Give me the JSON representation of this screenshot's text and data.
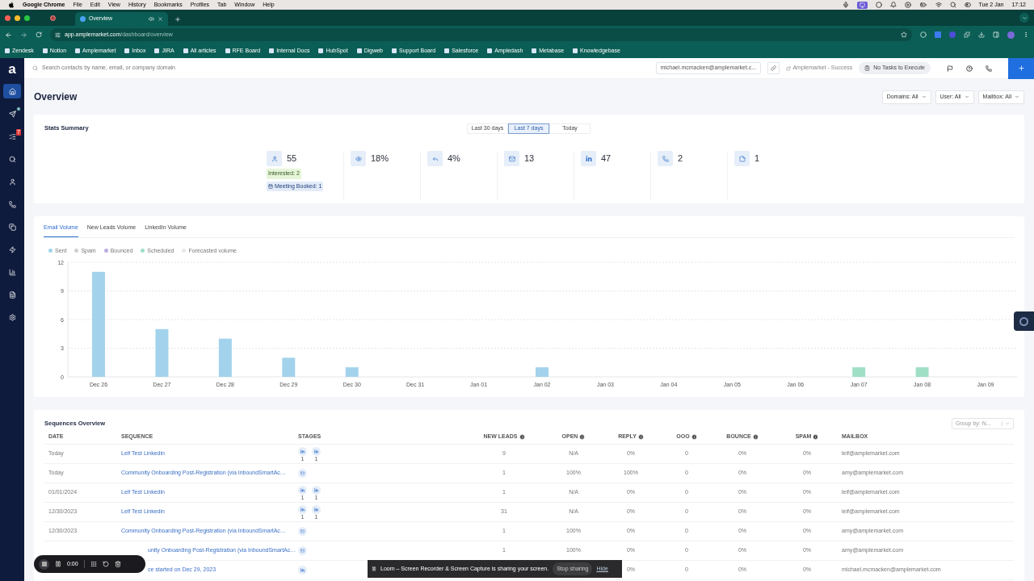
{
  "menubar": {
    "app": "Google Chrome",
    "menus": [
      "File",
      "Edit",
      "View",
      "History",
      "Bookmarks",
      "Profiles",
      "Tab",
      "Window",
      "Help"
    ],
    "date": "Tue 2 Jan",
    "time": "17:12"
  },
  "browser": {
    "tab_title": "Overview",
    "url_host": "app.amplemarket.com",
    "url_path": "/dashboard/overview",
    "bookmarks": [
      "Zendesk",
      "Notion",
      "Amplemarket",
      "Inbox",
      "JIRA",
      "All articles",
      "RFE Board",
      "Internal Docs",
      "HubSpot",
      "Digweb",
      "Support Board",
      "Salesforce",
      "Ampledash",
      "Metabase",
      "Knowledgebase"
    ]
  },
  "sidebar": {
    "logo": "a",
    "items": [
      {
        "selected": true,
        "indicator": false
      },
      {
        "selected": false,
        "indicator": true
      },
      {
        "selected": false,
        "indicator": false,
        "badge": "7"
      },
      {
        "selected": false,
        "indicator": false
      },
      {
        "selected": false,
        "indicator": false
      },
      {
        "selected": false,
        "indicator": false
      },
      {
        "selected": false,
        "indicator": false
      },
      {
        "selected": false,
        "indicator": false
      },
      {
        "selected": false,
        "indicator": false
      },
      {
        "selected": false,
        "indicator": false
      },
      {
        "selected": false,
        "indicator": false
      }
    ]
  },
  "topbar": {
    "search_placeholder": "Search contacts by name, email, or company domain",
    "account": "michael.mcmacken@amplemarket.c...",
    "link": "Amplemarket - Success",
    "tasks": "No Tasks to Execute"
  },
  "page": {
    "title": "Overview",
    "filters": [
      "Domains: All",
      "User: All",
      "Mailbox: All"
    ]
  },
  "stats": {
    "title": "Stats Summary",
    "ranges": [
      {
        "label": "Last 30 days",
        "selected": false
      },
      {
        "label": "Last 7 days",
        "selected": true
      },
      {
        "label": "Today",
        "selected": false
      }
    ],
    "items": [
      {
        "value": "55",
        "badges": [
          {
            "kind": "interest",
            "text": "Interested: 2"
          },
          {
            "kind": "meeting",
            "text": "Meeting Booked: 1"
          }
        ]
      },
      {
        "value": "18%"
      },
      {
        "value": "4%"
      },
      {
        "value": "13"
      },
      {
        "value": "47"
      },
      {
        "value": "2"
      },
      {
        "value": "1"
      }
    ]
  },
  "volume": {
    "tabs": [
      {
        "label": "Email Volume",
        "selected": true
      },
      {
        "label": "New Leads Volume",
        "selected": false
      },
      {
        "label": "LinkedIn Volume",
        "selected": false
      }
    ],
    "chart_data": {
      "type": "bar",
      "stacked": true,
      "grid": true,
      "categories": [
        "Dec 26",
        "Dec 27",
        "Dec 28",
        "Dec 29",
        "Dec 30",
        "Dec 31",
        "Jan 01",
        "Jan 02",
        "Jan 03",
        "Jan 04",
        "Jan 05",
        "Jan 06",
        "Jan 07",
        "Jan 08",
        "Jan 09"
      ],
      "ylim": [
        0,
        12
      ],
      "yticks": [
        0,
        3,
        6,
        9,
        12
      ],
      "series": [
        {
          "name": "Sent",
          "color": "#a3d3ec",
          "values": [
            11,
            5,
            4,
            2,
            1,
            0,
            0,
            1,
            0,
            0,
            0,
            0,
            0,
            0,
            0
          ]
        },
        {
          "name": "Spam",
          "color": "#cfcfcf",
          "values": [
            0,
            0,
            0,
            0,
            0,
            0,
            0,
            0,
            0,
            0,
            0,
            0,
            0,
            0,
            0
          ]
        },
        {
          "name": "Bounced",
          "color": "#bcaee0",
          "values": [
            0,
            0,
            0,
            0,
            0,
            0,
            0,
            0,
            0,
            0,
            0,
            0,
            0,
            0,
            0
          ]
        },
        {
          "name": "Scheduled",
          "color": "#9fdfc6",
          "values": [
            0,
            0,
            0,
            0,
            0,
            0,
            0,
            0,
            0,
            0,
            0,
            0,
            1,
            1,
            0
          ]
        },
        {
          "name": "Forecasted volume",
          "color": "#e8e8e8",
          "values": [
            0,
            0,
            0,
            0,
            0,
            0,
            0,
            0,
            0,
            0,
            0,
            0,
            0,
            0,
            0
          ]
        }
      ]
    }
  },
  "sequences": {
    "title": "Sequences Overview",
    "group_by": "Group by: N...",
    "columns": [
      {
        "label": "DATE",
        "info": false
      },
      {
        "label": "SEQUENCE",
        "info": false
      },
      {
        "label": "STAGES",
        "info": false
      },
      {
        "label": "NEW LEADS",
        "info": true
      },
      {
        "label": "OPEN",
        "info": true
      },
      {
        "label": "REPLY",
        "info": true
      },
      {
        "label": "OOO",
        "info": true
      },
      {
        "label": "BOUNCE",
        "info": true
      },
      {
        "label": "SPAM",
        "info": true
      },
      {
        "label": "MAILBOX",
        "info": false
      }
    ],
    "rows": [
      {
        "date": "Today",
        "sequence": "Leif Test Linkedin",
        "stages": [
          {
            "kind": "linkedin",
            "count": "1"
          },
          {
            "kind": "linkedin",
            "count": "1"
          }
        ],
        "new_leads": "9",
        "open": "N/A",
        "reply": "0%",
        "ooo": "0",
        "bounce": "0%",
        "spam": "0%",
        "mailbox": "leif@amplemarket.com"
      },
      {
        "date": "Today",
        "sequence": "Community Onboarding Post-Registration (via InboundSmartAc…",
        "stages": [
          {
            "kind": "email"
          }
        ],
        "new_leads": "1",
        "open": "100%",
        "reply": "100%",
        "ooo": "0",
        "bounce": "0%",
        "spam": "0%",
        "mailbox": "amy@amplemarket.com"
      },
      {
        "date": "01/01/2024",
        "sequence": "Leif Test Linkedin",
        "stages": [
          {
            "kind": "linkedin",
            "count": "1"
          },
          {
            "kind": "linkedin",
            "count": "1"
          }
        ],
        "new_leads": "1",
        "open": "N/A",
        "reply": "0%",
        "ooo": "0",
        "bounce": "0%",
        "spam": "0%",
        "mailbox": "leif@amplemarket.com"
      },
      {
        "date": "12/30/2023",
        "sequence": "Leif Test Linkedin",
        "stages": [
          {
            "kind": "linkedin",
            "count": "1"
          },
          {
            "kind": "linkedin",
            "count": "1"
          }
        ],
        "new_leads": "31",
        "open": "N/A",
        "reply": "0%",
        "ooo": "0",
        "bounce": "0%",
        "spam": "0%",
        "mailbox": "leif@amplemarket.com"
      },
      {
        "date": "12/30/2023",
        "sequence": "Community Onboarding Post-Registration (via InboundSmartAc…",
        "stages": [
          {
            "kind": "email"
          }
        ],
        "new_leads": "1",
        "open": "100%",
        "reply": "0%",
        "ooo": "0",
        "bounce": "0%",
        "spam": "0%",
        "mailbox": "amy@amplemarket.com"
      },
      {
        "sequence": "unity Onboarding Post-Registration (via InboundSmartAc…",
        "stages": [
          {
            "kind": "email"
          }
        ],
        "new_leads": "1",
        "open": "100%",
        "reply": "0%",
        "ooo": "0",
        "bounce": "0%",
        "spam": "0%",
        "mailbox": "amy@amplemarket.com"
      },
      {
        "sequence": "ce started on Dec 29, 2023",
        "stages": [
          {
            "kind": "linkedin"
          }
        ],
        "reply": "0%",
        "ooo": "0",
        "bounce": "0%",
        "spam": "0%",
        "mailbox": "michael.mcmacken@amplemarket.com"
      }
    ]
  },
  "recorder": {
    "time": "0:00"
  },
  "share_banner": {
    "message": "Loom – Screen Recorder & Screen Capture is sharing your screen.",
    "stop": "Stop sharing",
    "hide": "Hide"
  }
}
